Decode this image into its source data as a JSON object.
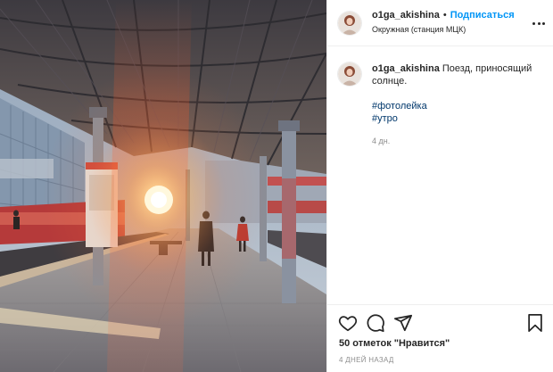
{
  "header": {
    "username": "o1ga_akishina",
    "separator": "•",
    "follow_label": "Подписаться",
    "location": "Окружная (станция МЦК)",
    "more_icon": "more-options-icon"
  },
  "caption": {
    "username": "o1ga_akishina",
    "text": "Поезд, приносящий солнце.",
    "hashtags": [
      "#фотолейка",
      "#утро"
    ],
    "age": "4 дн."
  },
  "actions": {
    "icons": [
      "heart-icon",
      "comment-icon",
      "share-icon",
      "bookmark-icon"
    ]
  },
  "likes": "50 отметок \"Нравится\"",
  "date": "4 ДНЕЙ НАЗАД",
  "colors": {
    "follow": "#0095f6",
    "hashtag": "#00376b",
    "meta": "#8e8e8e",
    "text": "#262626"
  }
}
